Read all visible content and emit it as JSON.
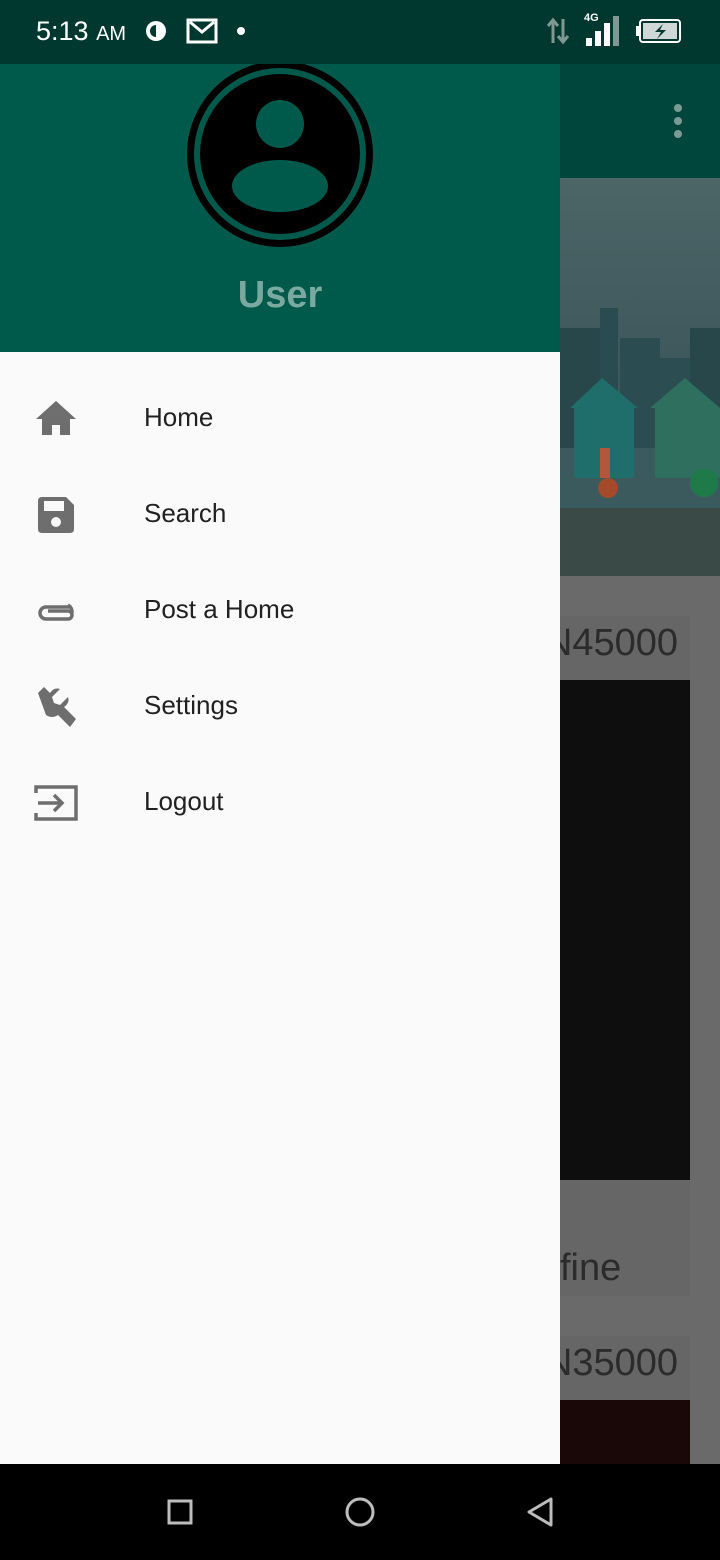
{
  "status_bar": {
    "time": "5:13",
    "ampm": "AM",
    "network": "4G"
  },
  "drawer": {
    "user_name": "User",
    "items": [
      {
        "label": "Home",
        "icon": "home-icon"
      },
      {
        "label": "Search",
        "icon": "save-icon"
      },
      {
        "label": "Post a Home",
        "icon": "attachment-icon"
      },
      {
        "label": "Settings",
        "icon": "wrench-icon"
      },
      {
        "label": "Logout",
        "icon": "login-icon"
      }
    ]
  },
  "background": {
    "cards": [
      {
        "price": "N45000",
        "tail": "fine"
      },
      {
        "price": "N35000"
      }
    ]
  },
  "colors": {
    "status_bar": "#00382f",
    "drawer_header": "#005a4c",
    "user_name": "#79a99f",
    "drawer_bg": "#fafafa",
    "icon": "#6e6e6e"
  }
}
